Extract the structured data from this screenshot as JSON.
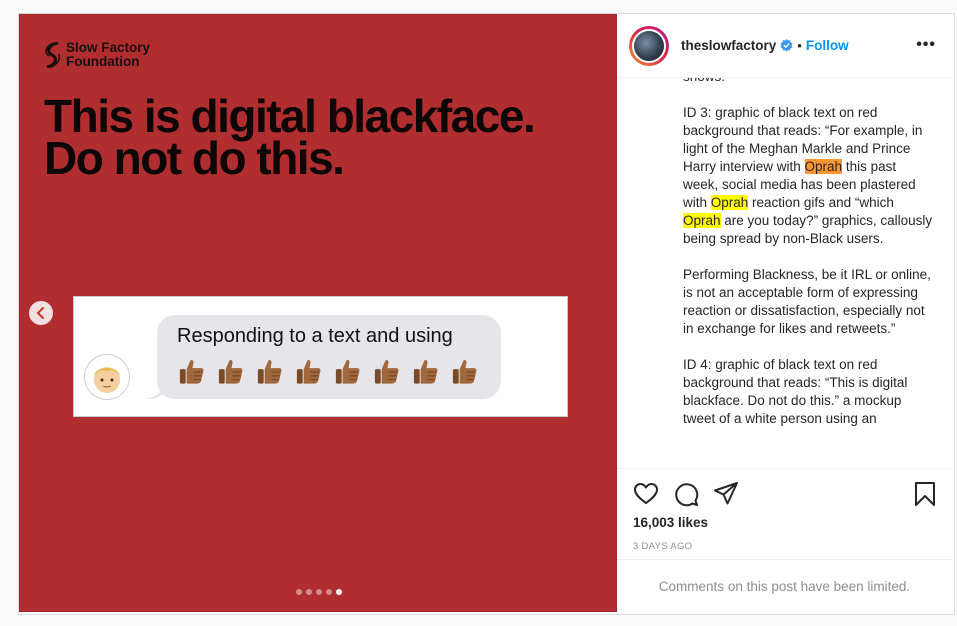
{
  "media": {
    "brand_line1": "Slow Factory",
    "brand_line2": "Foundation",
    "headline_line1": "This is digital blackface.",
    "headline_line2": "Do not do this.",
    "bubble_text": "Responding to a text and using",
    "thumbs_count": 8,
    "slide_count": 5,
    "active_slide": 5,
    "background_color": "#b12e30"
  },
  "header": {
    "username": "theslowfactory",
    "separator": "•",
    "follow_label": "Follow",
    "more_label": "•••"
  },
  "caption": {
    "p0": "shows.",
    "p1": {
      "a": "ID 3: graphic of black text on red background that reads: “For example, in light of the Meghan Markle and Prince Harry interview with ",
      "h1": "Oprah",
      "b": " this past week, social media has been plastered with ",
      "h2": "Oprah",
      "c": " reaction gifs and “which ",
      "h3": "Oprah",
      "d": " are you today?” graphics, callously being spread by non-Black users."
    },
    "p2": "Performing Blackness, be it IRL or online, is not an acceptable form of expressing reaction or dissatisfaction, especially not in exchange for likes and retweets.”",
    "p3": "ID 4: graphic of black text on red background that reads: “This is digital blackface. Do not do this.” a mockup tweet of a white person using an"
  },
  "stats": {
    "likes": "16,003 likes",
    "date": "3 DAYS AGO"
  },
  "comments_limited": "Comments on this post have been limited.",
  "icons": [
    "heart-icon",
    "comment-icon",
    "share-icon",
    "bookmark-icon",
    "verified-badge-icon",
    "chevron-left-icon"
  ],
  "colors": {
    "follow": "#0095f6",
    "highlight": "#ffff00",
    "highlight_current": "#ff9632"
  }
}
